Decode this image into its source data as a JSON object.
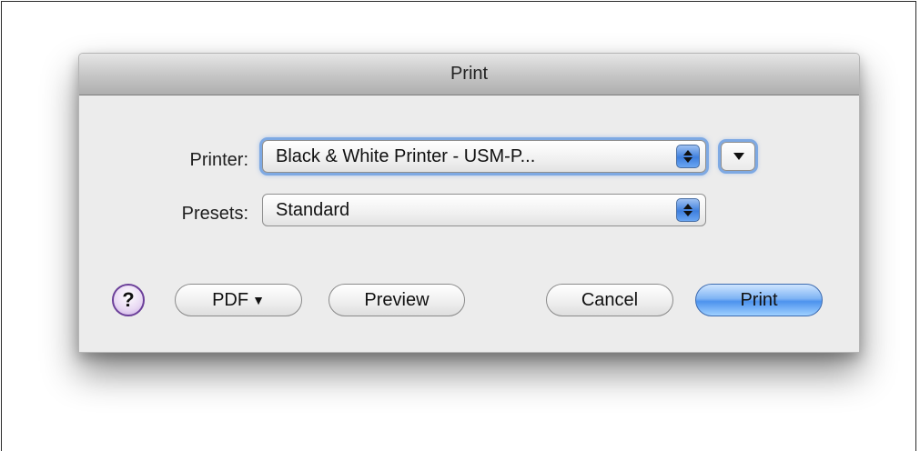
{
  "dialog": {
    "title": "Print"
  },
  "printer": {
    "label": "Printer:",
    "value": "Black & White Printer - USM-P..."
  },
  "presets": {
    "label": "Presets:",
    "value": "Standard"
  },
  "buttons": {
    "help": "?",
    "pdf": "PDF",
    "pdf_caret": "▼",
    "preview": "Preview",
    "cancel": "Cancel",
    "print": "Print"
  },
  "icons": {
    "stepper": "up-down-arrows-icon",
    "disclosure": "triangle-down-icon",
    "help": "question-mark-icon"
  },
  "colors": {
    "accent": "#5b9bf0",
    "help_ring": "#6b3f99"
  }
}
